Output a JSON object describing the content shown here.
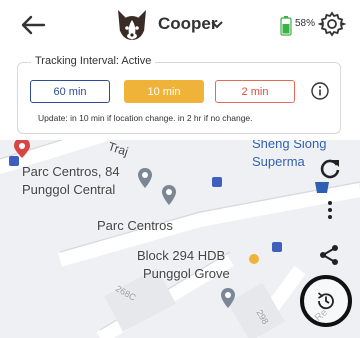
{
  "header": {
    "pet_name": "Cooper",
    "battery": "58%"
  },
  "tracking": {
    "title": "Tracking Interval: Active",
    "options": [
      "60 min",
      "10 min",
      "2 min"
    ],
    "selected": "10 min",
    "note": "Update: in 10 min if location change. in 2 hr if no change."
  },
  "map": {
    "labels": {
      "traj": "Traj",
      "parc_centros_84": "Parc Centros, 84",
      "punggol_central": "Punggol Central",
      "parc_centros": "Parc Centros",
      "block_294": "Block 294 HDB",
      "punggol_grove": "Punggol Grove",
      "sheng_siong": "Sheng Siong",
      "supermarket": "Superma",
      "road_268c": "268C",
      "road_298": "298",
      "road_re": "Re"
    }
  },
  "icons": [
    "back-arrow-icon",
    "dog-avatar-icon",
    "chevron-down-icon",
    "battery-icon",
    "gear-icon",
    "info-icon",
    "refresh-icon",
    "more-vertical-icon",
    "share-icon",
    "clock-history-icon",
    "map-pin-icon"
  ],
  "colors": {
    "selected_bg": "#f0b33a",
    "btn60": "#2e4a9a",
    "btn2": "#d94c3a",
    "battery": "#3cb043",
    "map_bg": "#eef0f3"
  }
}
